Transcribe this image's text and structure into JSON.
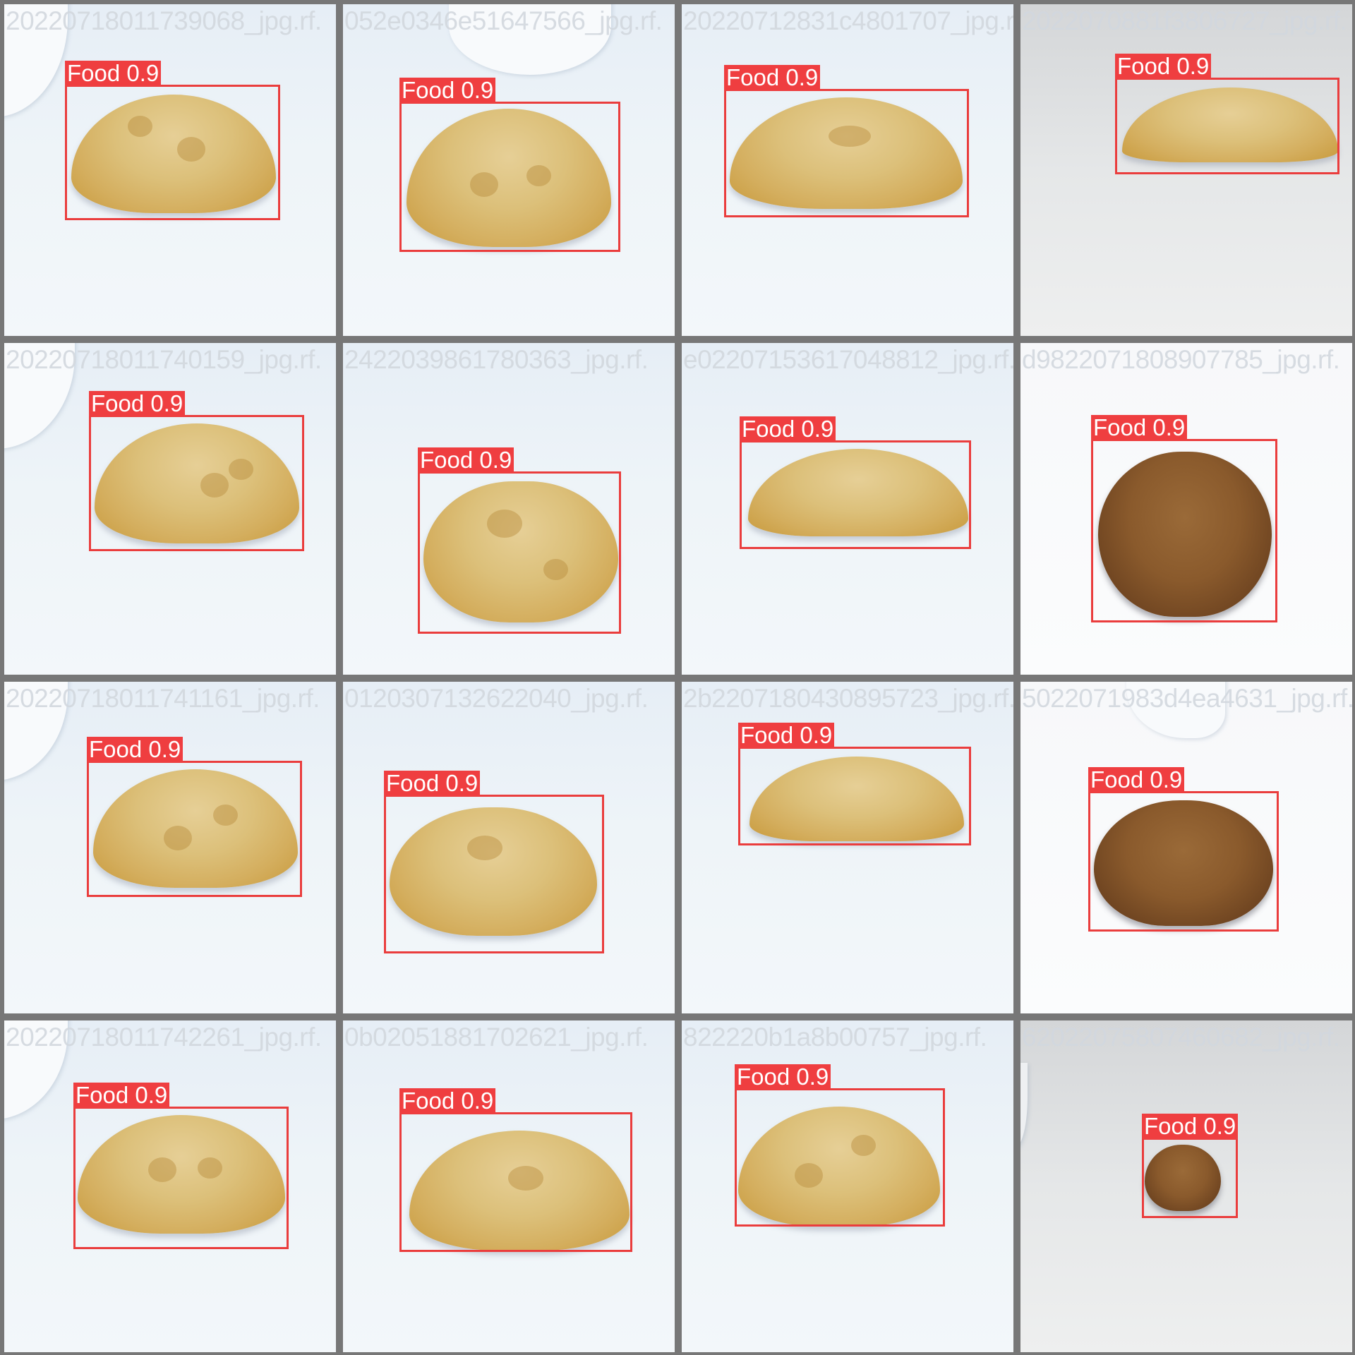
{
  "title": "",
  "colors": {
    "box": "#ea3d3d",
    "label_bg": "#ef3e40",
    "label_text": "#ffffff",
    "border": "#777777"
  },
  "tiles": [
    {
      "filename": "20220718011739068_jpg.rf.",
      "label": "Food 0.9",
      "food": "yellow"
    },
    {
      "filename": "052e0346e51647566_jpg.rf.",
      "label": "Food 0.9",
      "food": "yellow"
    },
    {
      "filename": "20220712831c4801707_jpg.rf.",
      "label": "Food 0.9",
      "food": "yellow"
    },
    {
      "filename": "2022070881f3806727_jpg.rf.",
      "label": "Food 0.9",
      "food": "yellow"
    },
    {
      "filename": "20220718011740159_jpg.rf.",
      "label": "Food 0.9",
      "food": "yellow"
    },
    {
      "filename": "2422039861780363_jpg.rf.",
      "label": "Food 0.9",
      "food": "yellow"
    },
    {
      "filename": "e02207153617048812_jpg.rf.",
      "label": "Food 0.9",
      "food": "yellow"
    },
    {
      "filename": "d9822071808907785_jpg.rf.",
      "label": "Food 0.9",
      "food": "brown"
    },
    {
      "filename": "20220718011741161_jpg.rf.",
      "label": "Food 0.9",
      "food": "yellow"
    },
    {
      "filename": "0120307132622040_jpg.rf.",
      "label": "Food 0.9",
      "food": "yellow"
    },
    {
      "filename": "2b2207180430895723_jpg.rf.",
      "label": "Food 0.9",
      "food": "yellow"
    },
    {
      "filename": "5022071983d4ea4631_jpg.rf.",
      "label": "Food 0.9",
      "food": "brown"
    },
    {
      "filename": "20220718011742261_jpg.rf.",
      "label": "Food 0.9",
      "food": "yellow"
    },
    {
      "filename": "0b02051881702621_jpg.rf.",
      "label": "Food 0.9",
      "food": "yellow"
    },
    {
      "filename": "822220b1a8b00757_jpg.rf.",
      "label": "Food 0.9",
      "food": "yellow"
    },
    {
      "filename": "62022075807460682_jpg.rf.",
      "label": "Food 0.9",
      "food": "brown"
    }
  ]
}
